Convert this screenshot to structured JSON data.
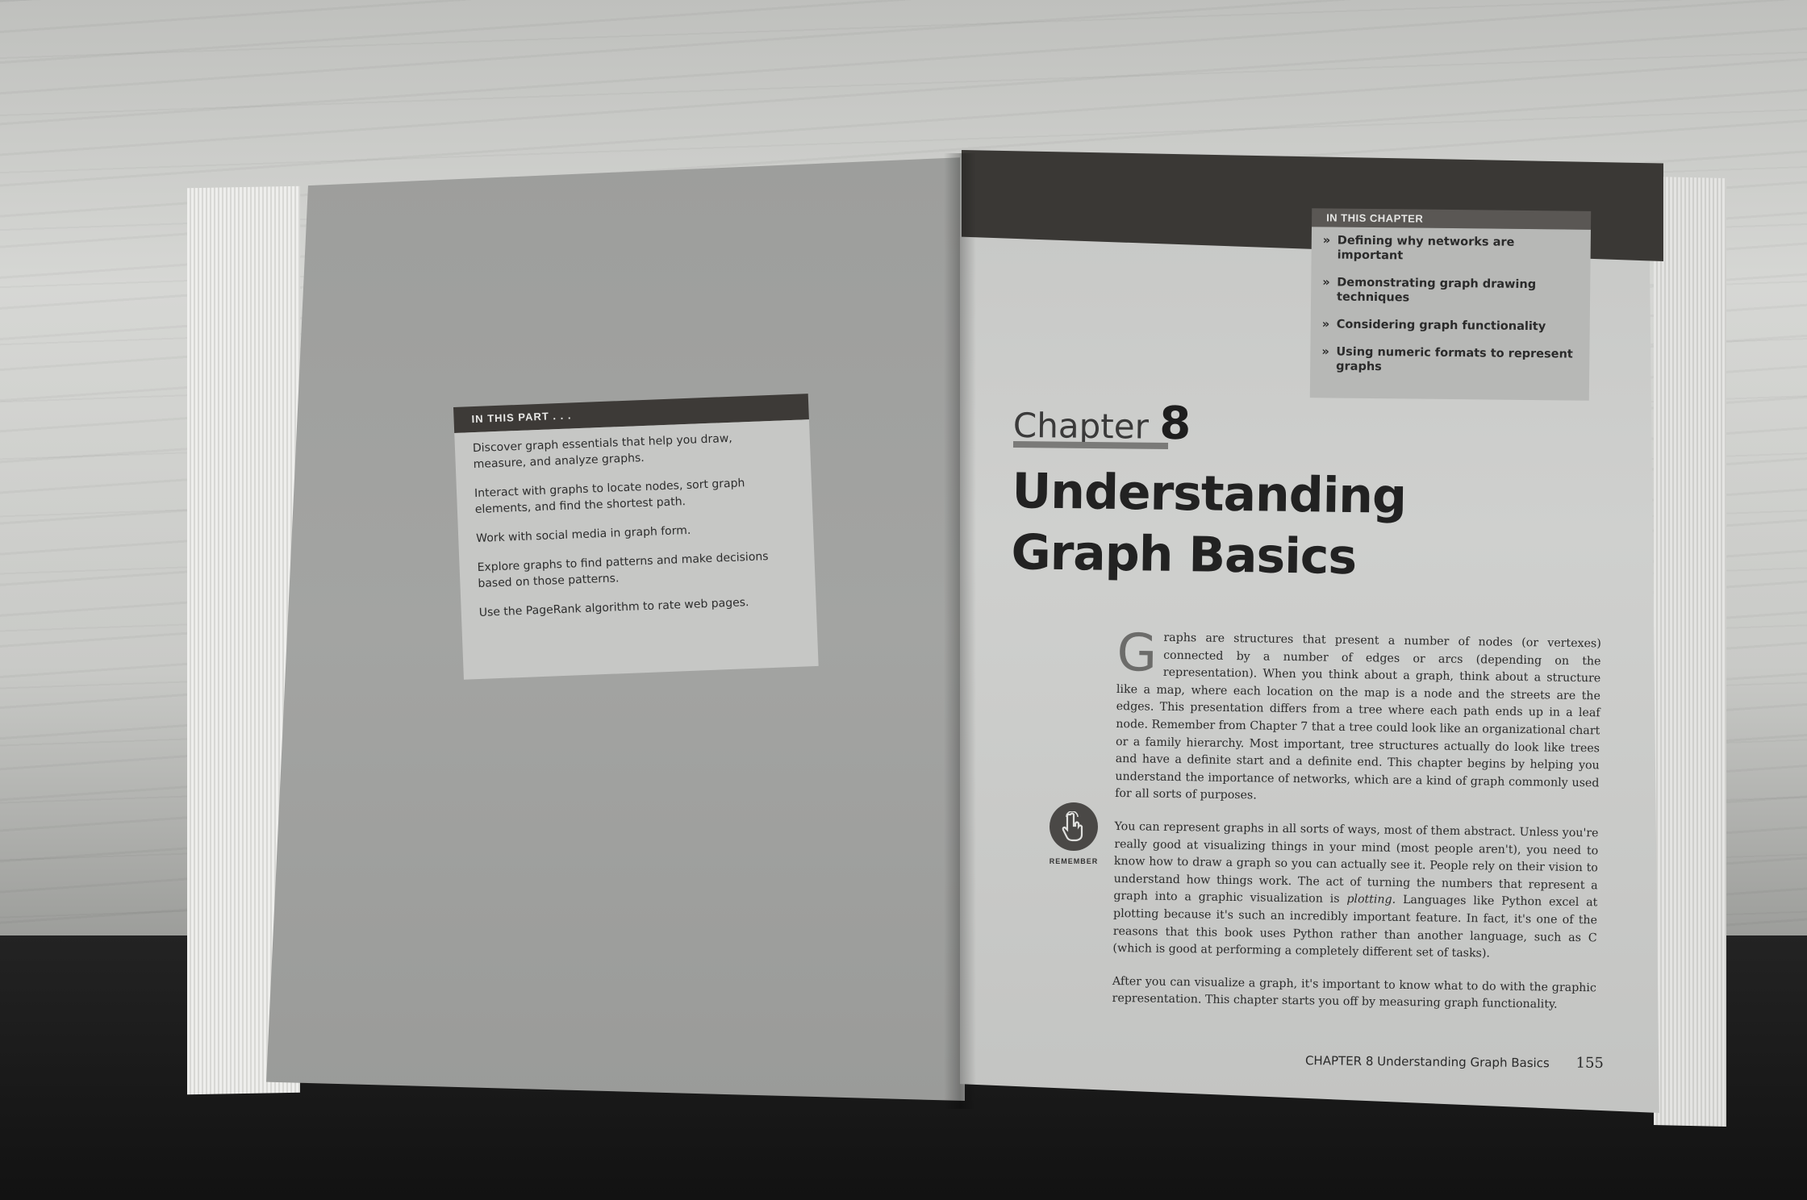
{
  "left_page": {
    "part_box": {
      "heading": "IN THIS PART . . .",
      "items": [
        "Discover graph essentials that help you draw, measure, and analyze graphs.",
        "Interact with graphs to locate nodes, sort graph elements, and find the shortest path.",
        "Work with social media in graph form.",
        "Explore graphs to find patterns and make decisions based on those patterns.",
        "Use the PageRank algorithm to rate web pages."
      ]
    }
  },
  "right_page": {
    "chapter_box": {
      "heading": "IN THIS CHAPTER",
      "bullet": "»",
      "items": [
        "Defining why networks are important",
        "Demonstrating graph drawing techniques",
        "Considering graph functionality",
        "Using numeric formats to represent graphs"
      ]
    },
    "chapter_word": "Chapter",
    "chapter_number": "8",
    "title_line1": "Understanding",
    "title_line2": "Graph Basics",
    "dropcap": "G",
    "paragraph1": "raphs are structures that present a number of nodes (or vertexes) connected by a number of edges or arcs (depending on the representation). When you think about a graph, think about a structure like a map, where each location on the map is a node and the streets are the edges. This presentation differs from a tree where each path ends up in a leaf node. Remember from Chapter 7 that a tree could look like an organizational chart or a family hierarchy. Most important, tree structures actually do look like trees and have a definite start and a definite end. This chapter begins by helping you understand the importance of networks, which are a kind of graph commonly used for all sorts of purposes.",
    "paragraph2_before": "You can represent graphs in all sorts of ways, most of them abstract. Unless you're really good at visualizing things in your mind (most people aren't), you need to know how to draw a graph so you can actually see it. People rely on their vision to understand how things work. The act of turning the numbers that represent a graph into a graphic visualization is ",
    "paragraph2_em": "plotting.",
    "paragraph2_after": " Languages like Python excel at plotting because it's such an incredibly important feature. In fact, it's one of the reasons that this book uses Python rather than another language, such as C (which is good at performing a completely different set of tasks).",
    "paragraph3": "After you can visualize a graph, it's important to know what to do with the graphic representation. This chapter starts you off by measuring graph functionality.",
    "remember_label": "REMEMBER",
    "remember_icon": "pointing-hand-icon",
    "footer_chapter": "CHAPTER 8",
    "footer_title": "Understanding Graph Basics",
    "page_number": "155"
  }
}
